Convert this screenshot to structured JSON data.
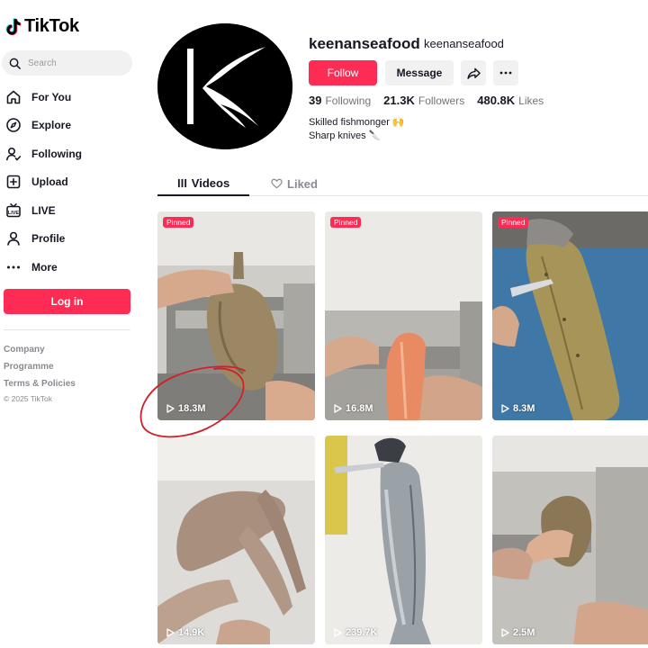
{
  "app": {
    "name": "TikTok"
  },
  "sidebar": {
    "search_placeholder": "Search",
    "items": [
      {
        "label": "For You",
        "icon": "home-icon"
      },
      {
        "label": "Explore",
        "icon": "compass-icon"
      },
      {
        "label": "Following",
        "icon": "following-icon"
      },
      {
        "label": "Upload",
        "icon": "plus-box-icon"
      },
      {
        "label": "LIVE",
        "icon": "live-icon"
      },
      {
        "label": "Profile",
        "icon": "person-icon"
      },
      {
        "label": "More",
        "icon": "more-dots-icon"
      }
    ],
    "login_label": "Log in",
    "footer": {
      "company": "Company",
      "programme": "Programme",
      "terms": "Terms & Policies",
      "copyright": "© 2025 TikTok"
    }
  },
  "profile": {
    "username": "keenanseafood",
    "nickname": "keenanseafood",
    "follow_label": "Follow",
    "message_label": "Message",
    "stats": {
      "following_count": "39",
      "following_label": "Following",
      "followers_count": "21.3K",
      "followers_label": "Followers",
      "likes_count": "480.8K",
      "likes_label": "Likes"
    },
    "bio_line1": "Skilled fishmonger 🙌",
    "bio_line2": "Sharp knives 🔪"
  },
  "tabs": {
    "videos": "Videos",
    "liked": "Liked"
  },
  "videos": [
    {
      "views": "18.3M",
      "pinned": "Pinned"
    },
    {
      "views": "16.8M",
      "pinned": "Pinned"
    },
    {
      "views": "8.3M",
      "pinned": "Pinned"
    },
    {
      "views": "14.9K"
    },
    {
      "views": "239.7K"
    },
    {
      "views": "2.5M"
    }
  ],
  "colors": {
    "brand": "#fe2c55",
    "annotation": "#d0202a"
  }
}
